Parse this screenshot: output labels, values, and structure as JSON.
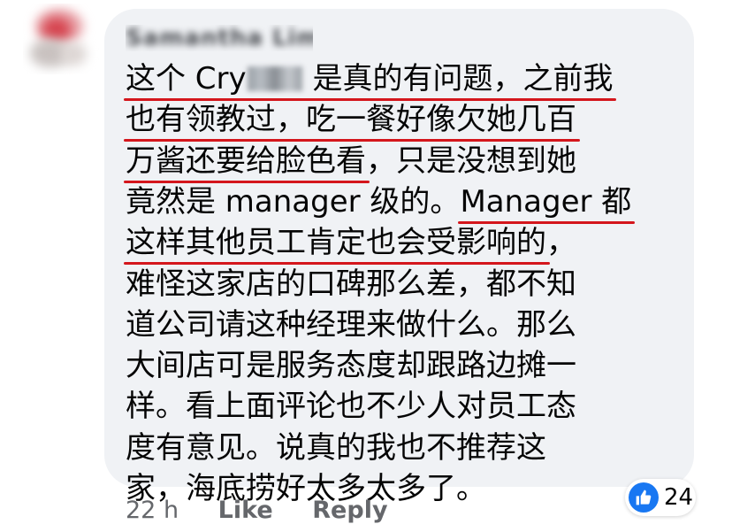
{
  "comment": {
    "author_name": "Samantha Lim",
    "lines": [
      {
        "segments": [
          {
            "text": "这个 Cry",
            "ul": true
          },
          {
            "redacted": true,
            "ul": true
          },
          {
            "text": " 是真的有问题",
            "ul": true
          },
          {
            "text": "，之前我",
            "ul": true
          }
        ]
      },
      {
        "segments": [
          {
            "text": "也有领教过，吃一餐好像欠她几百",
            "ul": true
          }
        ]
      },
      {
        "segments": [
          {
            "text": "万酱还要给脸色看",
            "ul": true
          },
          {
            "text": "，只是没想到她",
            "ul": false
          }
        ]
      },
      {
        "segments": [
          {
            "text": "竟然是 manager 级的。",
            "ul": false
          },
          {
            "text": "Manager 都",
            "ul": true
          }
        ]
      },
      {
        "segments": [
          {
            "text": "这样其他员工肯定也会受影响的",
            "ul": true
          },
          {
            "text": "，",
            "ul": false
          }
        ]
      },
      {
        "segments": [
          {
            "text": "难怪这家店的口碑那么差，都不知",
            "ul": false
          }
        ]
      },
      {
        "segments": [
          {
            "text": "道公司请这种经理来做什么。那么",
            "ul": false
          }
        ]
      },
      {
        "segments": [
          {
            "text": "大间店可是服务态度却跟路边摊一",
            "ul": false
          }
        ]
      },
      {
        "segments": [
          {
            "text": "样。看上面评论也不少人对员工态",
            "ul": false
          }
        ]
      },
      {
        "segments": [
          {
            "text": "度有意见。说真的我也不推荐这",
            "ul": false
          }
        ]
      },
      {
        "segments": [
          {
            "text": "家，海底捞好太多太多了。",
            "ul": false
          }
        ]
      }
    ]
  },
  "footer": {
    "time": "22 h",
    "like_label": "Like",
    "reply_label": "Reply"
  },
  "reactions": {
    "icon": "thumbs-up-icon",
    "count": "24",
    "color": "#1877f2"
  },
  "colors": {
    "bubble": "#f0f2f5",
    "underline": "#d4161c",
    "meta_text": "#65676b"
  }
}
